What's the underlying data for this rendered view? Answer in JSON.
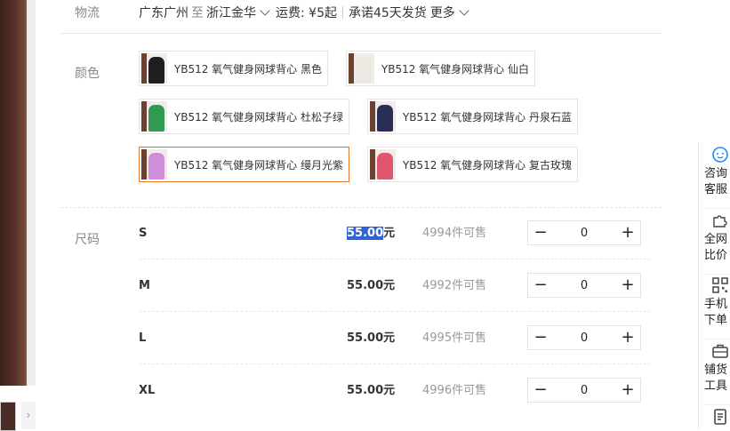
{
  "shipping": {
    "label": "物流",
    "from": "广东广州",
    "to_word": "至",
    "to": "浙江金华",
    "fee": "运费: ¥5起",
    "promise": "承诺45天发货",
    "more": "更多"
  },
  "colors": {
    "label": "颜色",
    "options": [
      {
        "name": "YB512 氧气健身网球背心 黑色",
        "swatch": "#1f1f22"
      },
      {
        "name": "YB512 氧气健身网球背心 仙白",
        "swatch": "#ece8e2"
      },
      {
        "name": "YB512 氧气健身网球背心 杜松子绿",
        "swatch": "#2f9a52"
      },
      {
        "name": "YB512 氧气健身网球背心 丹泉石蓝",
        "swatch": "#2a2f57"
      },
      {
        "name": "YB512 氧气健身网球背心 缦月光紫",
        "swatch": "#cf8fd8"
      },
      {
        "name": "YB512 氧气健身网球背心 复古玫瑰",
        "swatch": "#e0566e"
      }
    ],
    "selected_index": 4,
    "accent": "#e8792b"
  },
  "sizes": {
    "label": "尺码",
    "currency_unit": "元",
    "rows": [
      {
        "size": "S",
        "price": "55.00",
        "stock": "4994件可售",
        "qty": "0"
      },
      {
        "size": "M",
        "price": "55.00",
        "stock": "4992件可售",
        "qty": "0"
      },
      {
        "size": "L",
        "price": "55.00",
        "stock": "4995件可售",
        "qty": "0"
      },
      {
        "size": "XL",
        "price": "55.00",
        "stock": "4996件可售",
        "qty": "0"
      }
    ],
    "minus": "−",
    "plus": "+"
  },
  "sidebar": {
    "items": [
      {
        "line1": "咨询",
        "line2": "客服",
        "icon": "chat-icon"
      },
      {
        "line1": "全网",
        "line2": "比价",
        "icon": "puzzle-icon"
      },
      {
        "line1": "手机",
        "line2": "下单",
        "icon": "qr-code-icon"
      },
      {
        "line1": "铺货",
        "line2": "工具",
        "icon": "briefcase-icon"
      },
      {
        "line1": "",
        "line2": "",
        "icon": "document-icon"
      }
    ]
  },
  "gallery": {
    "next_arrow": "›"
  }
}
